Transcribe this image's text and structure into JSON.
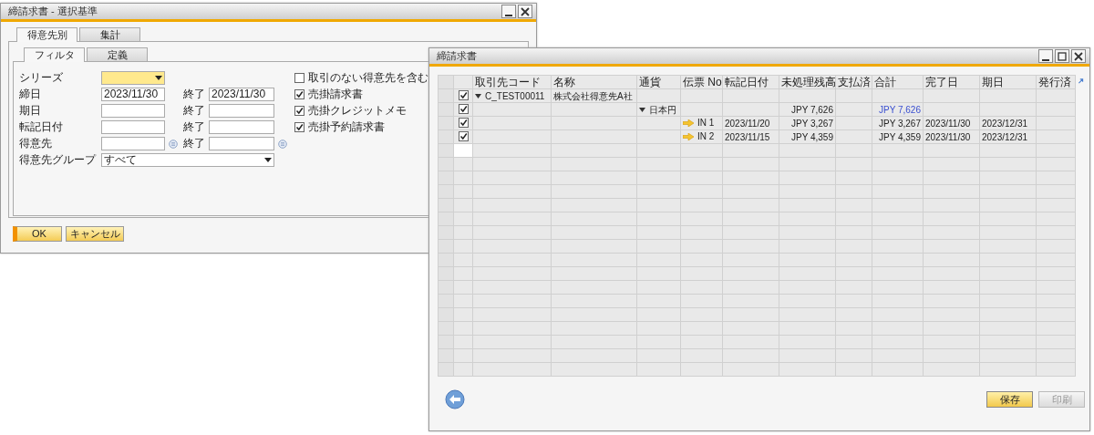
{
  "criteria_window": {
    "title": "締請求書 - 選択基準",
    "tabs": [
      {
        "label": "得意先別",
        "selected": true
      },
      {
        "label": "集計",
        "selected": false
      }
    ],
    "subtabs": [
      {
        "label": "フィルタ",
        "selected": true
      },
      {
        "label": "定義",
        "selected": false
      }
    ],
    "fields": [
      {
        "label": "シリーズ",
        "kind": "dropdown",
        "focused": true
      },
      {
        "label": "締日",
        "kind": "range",
        "value": "2023/11/30",
        "end_label": "終了",
        "end_value": "2023/11/30"
      },
      {
        "label": "期日",
        "kind": "range",
        "end_label": "終了"
      },
      {
        "label": "転記日付",
        "kind": "range",
        "end_label": "終了"
      },
      {
        "label": "得意先",
        "kind": "choose",
        "end_label": "終了"
      },
      {
        "label": "得意先グループ",
        "kind": "wide_dropdown",
        "value": "すべて"
      }
    ],
    "options": [
      {
        "label": "取引のない得意先を含む",
        "checked": false
      },
      {
        "label": "売掛請求書",
        "checked": true
      },
      {
        "label": "売掛クレジットメモ",
        "checked": true
      },
      {
        "label": "売掛予約請求書",
        "checked": true
      }
    ],
    "buttons": [
      {
        "label": "OK",
        "primary": true
      },
      {
        "label": "キャンセル",
        "primary": false
      }
    ]
  },
  "invoice_window": {
    "title": "締請求書",
    "columns": [
      {
        "label": "取引先コード"
      },
      {
        "label": "名称"
      },
      {
        "label": "通貨"
      },
      {
        "label": "伝票 No"
      },
      {
        "label": "転記日付"
      },
      {
        "label": "未処理残高"
      },
      {
        "label": "支払済"
      },
      {
        "label": "合計"
      },
      {
        "label": "完了日"
      },
      {
        "label": "期日"
      },
      {
        "label": "発行済"
      }
    ],
    "rows": [
      {
        "kind": "partner",
        "checked": true,
        "cells": [
          "C_TEST00011",
          "株式会社得意先A社",
          null,
          null,
          null,
          null,
          null,
          null,
          null,
          null,
          null
        ]
      },
      {
        "kind": "currency",
        "checked": true,
        "cells": [
          null,
          null,
          "日本円",
          null,
          null,
          "JPY 7,626",
          null,
          "JPY 7,626",
          null,
          null,
          null
        ]
      },
      {
        "kind": "document",
        "checked": true,
        "cells": [
          null,
          null,
          null,
          "IN 1",
          "2023/11/20",
          "JPY 3,267",
          null,
          "JPY 3,267",
          "2023/11/30",
          "2023/12/31",
          null
        ]
      },
      {
        "kind": "document",
        "checked": true,
        "cells": [
          null,
          null,
          null,
          "IN 2",
          "2023/11/15",
          "JPY 4,359",
          null,
          "JPY 4,359",
          "2023/11/30",
          "2023/12/31",
          null
        ]
      }
    ],
    "buttons": [
      {
        "label": "保存",
        "disabled": false
      },
      {
        "label": "印刷",
        "disabled": true
      }
    ]
  }
}
